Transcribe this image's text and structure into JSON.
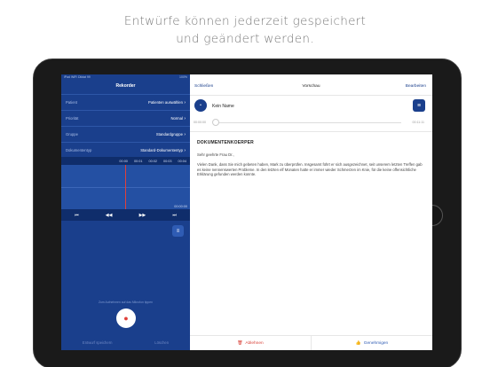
{
  "headline": {
    "line1": "Entwürfe können jederzeit gespeichert",
    "line2": "und geändert werden."
  },
  "statusbar": {
    "left": "iPad  WiFi  Diktat 99",
    "right": "100%"
  },
  "recorder": {
    "title": "Rekorder",
    "rows": [
      {
        "label": "Patient",
        "value": "Patienten auswählen"
      },
      {
        "label": "Priorität",
        "value": "Normal"
      },
      {
        "label": "Gruppe",
        "value": "Standardgruppe"
      },
      {
        "label": "Dokumententyp",
        "value": "Standard-Dokumententyp"
      }
    ],
    "timeline_ticks": [
      "00:00",
      "00:01",
      "00:02",
      "00:03",
      "00:04"
    ],
    "wave_time": "00:00:00",
    "controls": {
      "start": "⏮",
      "rewind": "◀◀",
      "forward": "▶▶",
      "end": "⏭"
    },
    "list_icon": "list-icon",
    "hint": "Zum Aufnehmen auf das Mikrofon tippen",
    "mic_icon": "microphone-icon",
    "footer": {
      "left": "Entwurf speichern",
      "right": "Löschen"
    }
  },
  "preview": {
    "nav": {
      "close": "Schließen",
      "title": "Vorschau",
      "edit": "Bearbeiten"
    },
    "patient_name": "Kein Name",
    "time_start": "00:00:00",
    "time_end": "00:11:11",
    "doc_title": "DOKUMENTENKOERPER",
    "salutation": "Sehr geehrte Frau Dr.,",
    "body": "Vielen Dank, dass Sie mich gebeten haben, Mark zu überprüfen. Insgesamt führt er sich ausgezeichnet, seit unserem letzten Treffen gab es keine nennenswerten Probleme. In den letzten elf Monaten hatte er immer wieder Schmerzen im Knie, für die keine offensichtliche Erklärung gefunden werden konnte.",
    "footer": {
      "reject": "Ablehnen",
      "approve": "Genehmigen"
    }
  },
  "colors": {
    "brand": "#1a3f8c",
    "reject": "#d9433a",
    "record": "#e0403a"
  }
}
